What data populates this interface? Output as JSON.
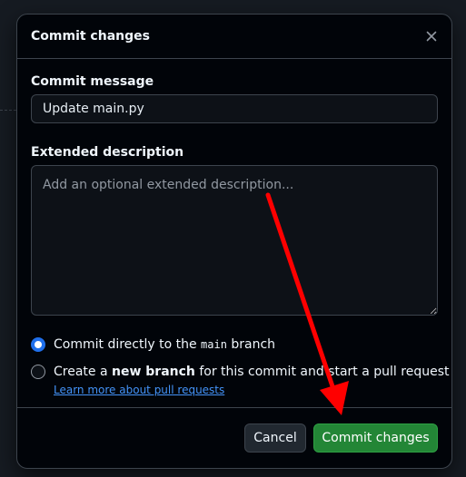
{
  "dialog": {
    "title": "Commit changes",
    "close_icon": "close-icon"
  },
  "form": {
    "message_label": "Commit message",
    "message_value": "Update main.py",
    "description_label": "Extended description",
    "description_placeholder": "Add an optional extended description...",
    "options": {
      "direct_prefix": "Commit directly to the ",
      "direct_branch": "main",
      "direct_suffix": " branch",
      "new_prefix": "Create a ",
      "new_bold": "new branch",
      "new_suffix": " for this commit and start a pull request",
      "selected": "direct"
    },
    "learn_more": "Learn more about pull requests"
  },
  "footer": {
    "cancel_label": "Cancel",
    "commit_label": "Commit changes"
  },
  "colors": {
    "dialog_bg": "#010409",
    "accent_blue": "#1f6feb",
    "link": "#4493f8",
    "commit_green": "#238636",
    "annotation_red": "#ff0000"
  }
}
